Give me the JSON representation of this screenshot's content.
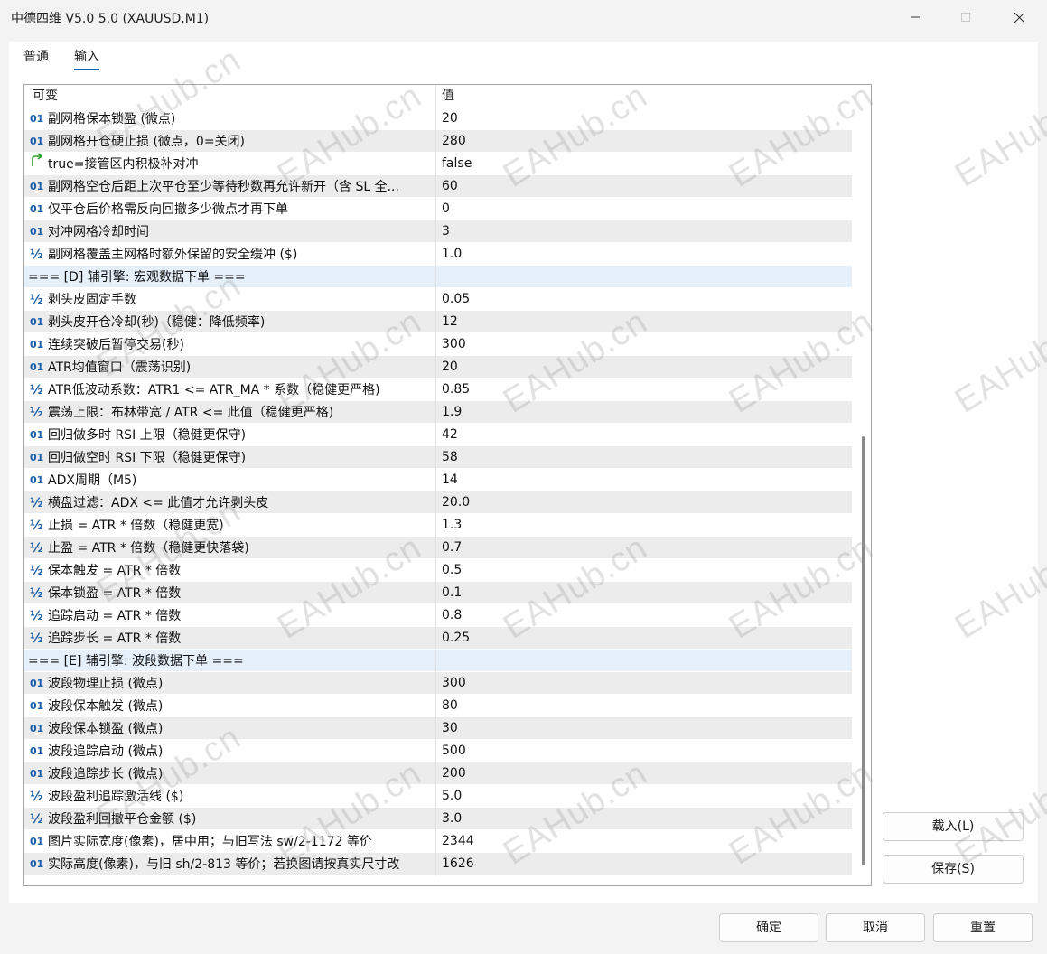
{
  "window": {
    "title": "中德四维 V5.0 5.0 (XAUUSD,M1)"
  },
  "tabs": [
    {
      "label": "普通",
      "active": false
    },
    {
      "label": "输入",
      "active": true
    }
  ],
  "grid": {
    "header_name": "可变",
    "header_value": "值",
    "rows": [
      {
        "icon": "01",
        "name": "副网格保本锁盈 (微点)",
        "value": "20"
      },
      {
        "icon": "01",
        "name": "副网格开仓硬止损 (微点，0=关闭)",
        "value": "280"
      },
      {
        "icon": "bool",
        "name": "true=接管区内积极补对冲",
        "value": "false"
      },
      {
        "icon": "01",
        "name": "副网格空仓后距上次平仓至少等待秒数再允许新开（含 SL 全...",
        "value": "60"
      },
      {
        "icon": "01",
        "name": "仅平仓后价格需反向回撤多少微点才再下单",
        "value": "0"
      },
      {
        "icon": "01",
        "name": "对冲网格冷却时间",
        "value": "3"
      },
      {
        "icon": "half",
        "name": "副网格覆盖主网格时额外保留的安全缓冲 ($)",
        "value": "1.0"
      },
      {
        "icon": "section",
        "name": "=== [D] 辅引擎: 宏观数据下单 ===",
        "value": ""
      },
      {
        "icon": "half",
        "name": "剥头皮固定手数",
        "value": "0.05"
      },
      {
        "icon": "01",
        "name": "剥头皮开仓冷却(秒)（稳健：降低频率)",
        "value": "12"
      },
      {
        "icon": "01",
        "name": "连续突破后暂停交易(秒)",
        "value": "300"
      },
      {
        "icon": "01",
        "name": "ATR均值窗口（震荡识别)",
        "value": "20"
      },
      {
        "icon": "half",
        "name": "ATR低波动系数：ATR1 <= ATR_MA * 系数（稳健更严格)",
        "value": "0.85"
      },
      {
        "icon": "half",
        "name": "震荡上限：布林带宽 / ATR <= 此值（稳健更严格)",
        "value": "1.9"
      },
      {
        "icon": "01",
        "name": "回归做多时 RSI 上限（稳健更保守)",
        "value": "42"
      },
      {
        "icon": "01",
        "name": "回归做空时 RSI 下限（稳健更保守)",
        "value": "58"
      },
      {
        "icon": "01",
        "name": "ADX周期（M5)",
        "value": "14"
      },
      {
        "icon": "half",
        "name": "横盘过滤：ADX <= 此值才允许剥头皮",
        "value": "20.0"
      },
      {
        "icon": "half",
        "name": "止损 = ATR * 倍数（稳健更宽)",
        "value": "1.3"
      },
      {
        "icon": "half",
        "name": "止盈 = ATR * 倍数（稳健更快落袋)",
        "value": "0.7"
      },
      {
        "icon": "half",
        "name": "保本触发 = ATR * 倍数",
        "value": "0.5"
      },
      {
        "icon": "half",
        "name": "保本锁盈 = ATR * 倍数",
        "value": "0.1"
      },
      {
        "icon": "half",
        "name": "追踪启动 = ATR * 倍数",
        "value": "0.8"
      },
      {
        "icon": "half",
        "name": "追踪步长 = ATR * 倍数",
        "value": "0.25"
      },
      {
        "icon": "section",
        "name": "=== [E] 辅引擎: 波段数据下单 ===",
        "value": ""
      },
      {
        "icon": "01",
        "name": "波段物理止损 (微点)",
        "value": "300"
      },
      {
        "icon": "01",
        "name": "波段保本触发 (微点)",
        "value": "80"
      },
      {
        "icon": "01",
        "name": "波段保本锁盈 (微点)",
        "value": "30"
      },
      {
        "icon": "01",
        "name": "波段追踪启动 (微点)",
        "value": "500"
      },
      {
        "icon": "01",
        "name": "波段追踪步长 (微点)",
        "value": "200"
      },
      {
        "icon": "half",
        "name": "波段盈利追踪激活线 ($)",
        "value": "5.0"
      },
      {
        "icon": "half",
        "name": "波段盈利回撤平仓金额 ($)",
        "value": "3.0"
      },
      {
        "icon": "01",
        "name": "图片实际宽度(像素)，居中用；与旧写法 sw/2-1172 等价",
        "value": "2344"
      },
      {
        "icon": "01",
        "name": "实际高度(像素)，与旧 sh/2-813 等价；若换图请按真实尺寸改",
        "value": "1626"
      }
    ]
  },
  "buttons": {
    "load": "载入(L)",
    "save": "保存(S)",
    "ok": "确定",
    "cancel": "取消",
    "reset": "重置"
  },
  "watermark": "EAHub.cn"
}
